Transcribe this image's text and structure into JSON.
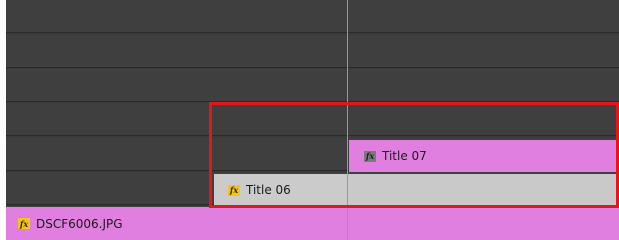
{
  "clips": {
    "title07": {
      "icon": "fx-icon",
      "fx_text": "fx",
      "label": "Title 07"
    },
    "title06": {
      "icon": "fx-icon",
      "fx_text": "fx",
      "label": "Title 06"
    },
    "dsc": {
      "icon": "fx-icon",
      "fx_text": "fx",
      "label": "DSCF6006.JPG"
    }
  },
  "colors": {
    "track_bg": "#3f3f3f",
    "clip_pink": "#e17fe0",
    "clip_grey": "#cbcbcb",
    "playhead": "#5aa8e8",
    "highlight": "#e4161c",
    "fx_badge_yellow": "#f2c51c",
    "fx_badge_grey": "#7a7a7a"
  }
}
